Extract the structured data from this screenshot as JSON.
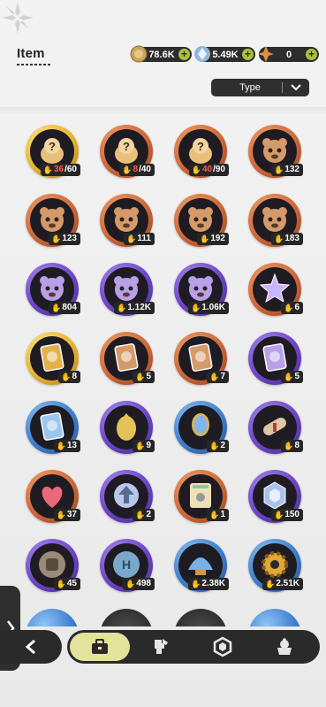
{
  "header": {
    "title": "Item"
  },
  "currencies": [
    {
      "icon": "coin-icon",
      "value": "78.6K",
      "color": "#c9a45a"
    },
    {
      "icon": "crystal-gear-icon",
      "value": "5.49K",
      "color": "#8fb7d8"
    },
    {
      "icon": "star-shard-icon",
      "value": "0",
      "color": "#e08f3e"
    }
  ],
  "filter": {
    "label": "Type"
  },
  "items": [
    {
      "icon": "mystery-cookie-bag-icon",
      "ring": "gold",
      "have": "36",
      "need": "/60"
    },
    {
      "icon": "mystery-cookie-bag-icon",
      "ring": "bronze",
      "have": "8",
      "need": "/40"
    },
    {
      "icon": "mystery-cookie-bag-icon",
      "ring": "bronze",
      "have": "40",
      "need": "/90"
    },
    {
      "icon": "bear-jelly-icon",
      "ring": "bronze",
      "qty": "132"
    },
    {
      "icon": "knight-bear-icon",
      "ring": "bronze",
      "qty": "123"
    },
    {
      "icon": "bunny-jelly-icon",
      "ring": "bronze",
      "qty": "111"
    },
    {
      "icon": "dark-bear-icon",
      "ring": "bronze",
      "qty": "192"
    },
    {
      "icon": "purple-bear-icon",
      "ring": "bronze",
      "qty": "183"
    },
    {
      "icon": "green-bear-icon",
      "ring": "purple",
      "qty": "804"
    },
    {
      "icon": "eyepatch-bear-icon",
      "ring": "purple",
      "qty": "1.12K"
    },
    {
      "icon": "gold-bear-icon",
      "ring": "purple",
      "qty": "1.06K"
    },
    {
      "icon": "crystal-star-icon",
      "ring": "bronze",
      "qty": "6"
    },
    {
      "icon": "gold-card-pack-icon",
      "ring": "gold",
      "qty": "8"
    },
    {
      "icon": "blue-card-pack-icon",
      "ring": "bronze",
      "qty": "5"
    },
    {
      "icon": "amber-card-pack-icon",
      "ring": "bronze",
      "qty": "7"
    },
    {
      "icon": "purple-card-pack-icon",
      "ring": "purple",
      "qty": "5"
    },
    {
      "icon": "silver-card-pack-icon",
      "ring": "blue",
      "qty": "13"
    },
    {
      "icon": "golden-egg-icon",
      "ring": "purple",
      "qty": "9"
    },
    {
      "icon": "magic-mirror-icon",
      "ring": "blue",
      "qty": "2"
    },
    {
      "icon": "scroll-icon",
      "ring": "purple",
      "qty": "8"
    },
    {
      "icon": "ruby-heart-icon",
      "ring": "bronze",
      "qty": "37"
    },
    {
      "icon": "upgrade-arrow-icon",
      "ring": "purple",
      "qty": "2"
    },
    {
      "icon": "rainbow-ticket-icon",
      "ring": "bronze",
      "qty": "1"
    },
    {
      "icon": "crystal-emblem-icon",
      "ring": "purple",
      "qty": "150"
    },
    {
      "icon": "fist-medal-icon",
      "ring": "purple",
      "qty": "45"
    },
    {
      "icon": "silver-coin-icon",
      "ring": "purple",
      "qty": "498"
    },
    {
      "icon": "scale-shell-icon",
      "ring": "blue",
      "qty": "2.38K"
    },
    {
      "icon": "gear-cog-icon",
      "ring": "blue",
      "qty": "2.51K"
    }
  ],
  "bottom_nav": {
    "back_icon": "chevron-left-icon",
    "tabs": [
      {
        "icon": "briefcase-icon",
        "active": true
      },
      {
        "icon": "costume-icon",
        "active": false
      },
      {
        "icon": "gem-hexagon-icon",
        "active": false
      },
      {
        "icon": "dessert-icon",
        "active": false
      }
    ]
  },
  "colors": {
    "bar": "#2a2a2a",
    "active_tab": "#e4e39b",
    "plus": "#a8c23a"
  }
}
